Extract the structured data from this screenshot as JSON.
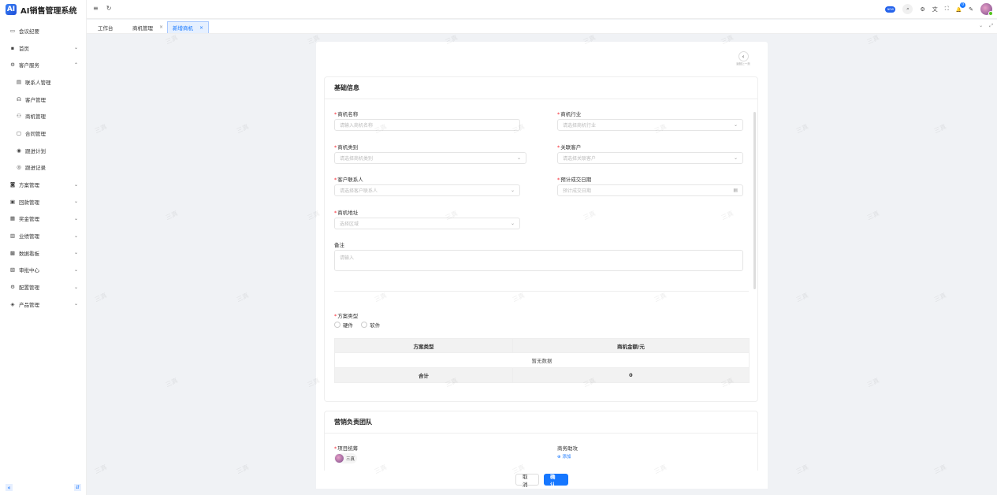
{
  "app": {
    "logo_letter": "AI",
    "title": "AI销售管理系统"
  },
  "sidebar": {
    "items": [
      {
        "label": "会议纪要",
        "icon": "monitor-icon",
        "glyph": "▭"
      },
      {
        "label": "首页",
        "icon": "grid-icon",
        "glyph": "▪",
        "chevron": "⌄"
      },
      {
        "label": "客户服务",
        "icon": "settings-icon",
        "glyph": "⚙",
        "chevron": "⌃"
      },
      {
        "label": "联系人管理",
        "icon": "contacts-icon",
        "glyph": "▤",
        "sub": true
      },
      {
        "label": "客户管理",
        "icon": "headset-icon",
        "glyph": "☊",
        "sub": true
      },
      {
        "label": "商机管理",
        "icon": "people-icon",
        "glyph": "⚇",
        "sub": true
      },
      {
        "label": "合同管理",
        "icon": "document-icon",
        "glyph": "▢",
        "sub": true
      },
      {
        "label": "跟进计划",
        "icon": "plan-icon",
        "glyph": "◉",
        "sub": true
      },
      {
        "label": "跟进记录",
        "icon": "record-icon",
        "glyph": "◎",
        "sub": true
      },
      {
        "label": "方案管理",
        "icon": "solution-icon",
        "glyph": "◙",
        "chevron": "⌄"
      },
      {
        "label": "回款管理",
        "icon": "payment-icon",
        "glyph": "▣",
        "chevron": "⌄"
      },
      {
        "label": "奖金管理",
        "icon": "bonus-icon",
        "glyph": "▦",
        "chevron": "⌄"
      },
      {
        "label": "业绩管理",
        "icon": "chart-icon",
        "glyph": "▥",
        "chevron": "⌄"
      },
      {
        "label": "数据看板",
        "icon": "dashboard-icon",
        "glyph": "▩",
        "chevron": "⌄"
      },
      {
        "label": "审批中心",
        "icon": "approval-icon",
        "glyph": "▧",
        "chevron": "⌄"
      },
      {
        "label": "配置管理",
        "icon": "config-icon",
        "glyph": "⚙",
        "chevron": "⌄"
      },
      {
        "label": "产品管理",
        "icon": "product-icon",
        "glyph": "◈",
        "chevron": "⌄"
      }
    ],
    "collapse_glyph": "«",
    "expand_glyph": "⇵"
  },
  "topbar": {
    "menu_glyph": "≡",
    "refresh_glyph": "↻",
    "pill_text": "NEW",
    "search_glyph": "⌕",
    "settings_glyph": "⚙",
    "translate_glyph": "文",
    "fullscreen_glyph": "⛶",
    "bell_glyph": "🔔",
    "bell_badge": "0",
    "wrench_glyph": "✎"
  },
  "tabs": [
    {
      "label": "工作台",
      "closable": false
    },
    {
      "label": "商机管理",
      "closable": true,
      "close_glyph": "×"
    },
    {
      "label": "新增商机",
      "closable": true,
      "close_glyph": "×",
      "active": true
    }
  ],
  "tabbar_right": {
    "dropdown_glyph": "⌄",
    "expand_glyph": "⤢"
  },
  "page": {
    "back_glyph": "‹",
    "back_text": "返回上一页",
    "basic": {
      "title": "基础信息",
      "fields": {
        "name": {
          "label": "商机名称",
          "placeholder": "请输入商机名称"
        },
        "industry": {
          "label": "商机行业",
          "placeholder": "请选择商机行业",
          "arrow": "⌄"
        },
        "type": {
          "label": "商机类别",
          "placeholder": "请选择商机类别",
          "arrow": "⌄"
        },
        "customer": {
          "label": "关联客户",
          "placeholder": "请选择关联客户",
          "arrow": "⌄"
        },
        "contact": {
          "label": "客户联系人",
          "placeholder": "请选择客户联系人",
          "arrow": "⌄"
        },
        "deal_date": {
          "label": "预计成交日期",
          "placeholder": "预计成交日期",
          "arrow": "▤"
        },
        "address": {
          "label": "商机地址",
          "placeholder": "选择区域",
          "arrow": "⌄"
        },
        "remark": {
          "label": "备注",
          "placeholder": "请输入"
        }
      },
      "scheme": {
        "label": "方案类型",
        "options": [
          "硬件",
          "软件"
        ],
        "table": {
          "headers": [
            "方案类型",
            "商机金额/元"
          ],
          "empty_text": "暂无数据",
          "sum_label": "合计",
          "sum_value": "0"
        }
      }
    },
    "team": {
      "title": "营销负责团队",
      "lead_label": "项目统筹",
      "lead_user": "三真",
      "assist_label": "商务助攻",
      "add_text": "⊕ 添加"
    }
  },
  "footer": {
    "cancel": "取 消",
    "confirm": "确 认"
  },
  "watermark": "三真"
}
